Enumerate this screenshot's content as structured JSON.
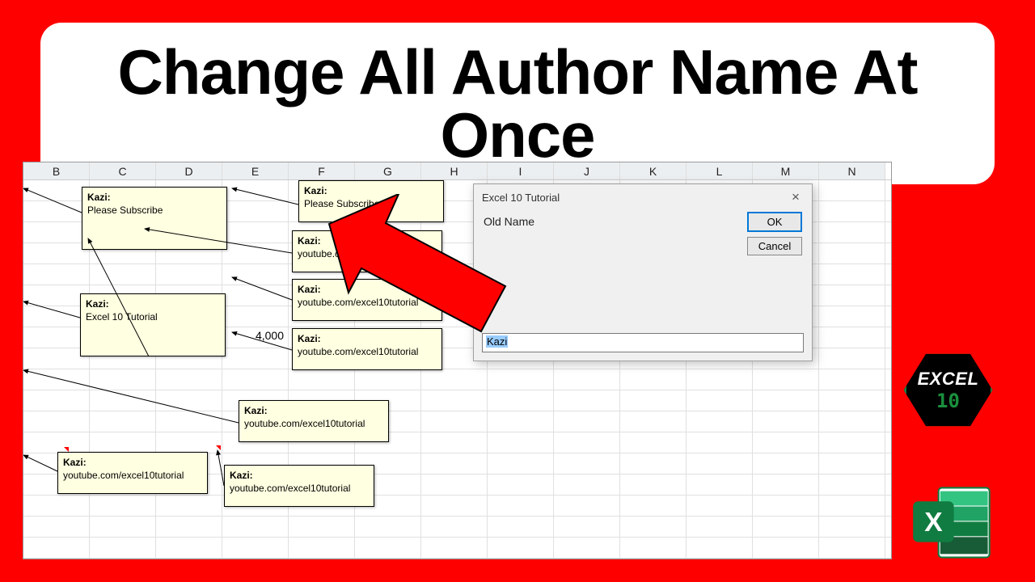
{
  "title": "Change All Author Name At Once",
  "columns": [
    "B",
    "C",
    "D",
    "E",
    "F",
    "G",
    "H",
    "I",
    "J",
    "K",
    "L",
    "M",
    "N"
  ],
  "cells": {
    "e_val": "4,000"
  },
  "comment_author": "Kazi:",
  "comments": {
    "c1": "Please Subscribe",
    "c2": "Please Subscribe",
    "c3": "youtube.c",
    "c3b": "excel10tutorial",
    "c4": "Excel 10 Tutorial",
    "c5": "youtube.com/excel10tutorial",
    "c6": "youtube.com/excel10tutorial",
    "c7": "youtube.com/excel10tutorial",
    "c8": "youtube.com/excel10tutorial",
    "c9": "youtube.com/excel10tutorial"
  },
  "dialog": {
    "title": "Excel 10 Tutorial",
    "label": "Old Name",
    "value": "Kazi",
    "ok": "OK",
    "cancel": "Cancel"
  },
  "badge": {
    "line1": "EXCEL",
    "line2": "10"
  },
  "excel_icon_letter": "X"
}
